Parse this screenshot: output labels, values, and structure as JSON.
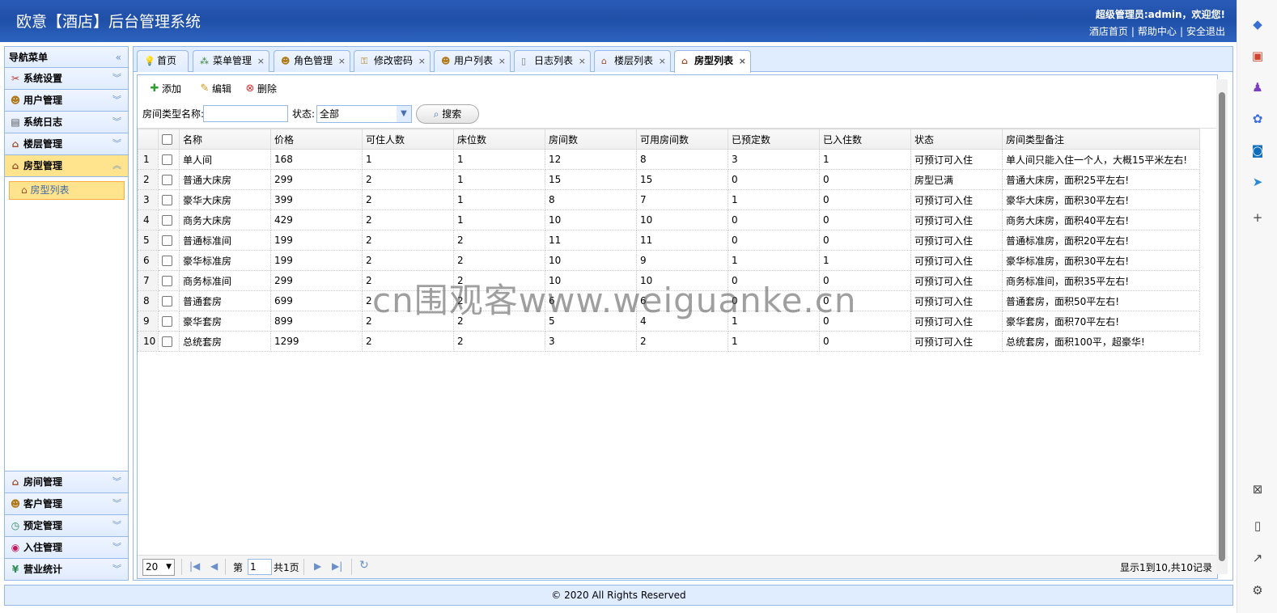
{
  "header": {
    "title": "欧意【酒店】后台管理系统",
    "user_text": "超级管理员:admin，欢迎您!",
    "links": [
      "酒店首页",
      "帮助中心",
      "安全退出"
    ]
  },
  "sidebar": {
    "title": "导航菜单",
    "top_items": [
      {
        "label": "系统设置"
      },
      {
        "label": "用户管理"
      },
      {
        "label": "系统日志"
      },
      {
        "label": "楼层管理"
      },
      {
        "label": "房型管理"
      }
    ],
    "sub_item": "房型列表",
    "bottom_items": [
      {
        "label": "房间管理"
      },
      {
        "label": "客户管理"
      },
      {
        "label": "预定管理"
      },
      {
        "label": "入住管理"
      },
      {
        "label": "营业统计"
      }
    ]
  },
  "tabs": [
    "首页",
    "菜单管理",
    "角色管理",
    "修改密码",
    "用户列表",
    "日志列表",
    "楼层列表",
    "房型列表"
  ],
  "toolbar": {
    "add": "添加",
    "edit": "编辑",
    "delete": "删除"
  },
  "search": {
    "name_label": "房间类型名称:",
    "name_value": "",
    "status_label": "状态:",
    "status_value": "全部",
    "button": "搜索"
  },
  "table": {
    "columns": [
      "名称",
      "价格",
      "可住人数",
      "床位数",
      "房间数",
      "可用房间数",
      "已预定数",
      "已入住数",
      "状态",
      "房间类型备注"
    ],
    "rows": [
      [
        "1",
        "单人间",
        "168",
        "1",
        "1",
        "12",
        "8",
        "3",
        "1",
        "可预订可入住",
        "单人间只能入住一个人，大概15平米左右!"
      ],
      [
        "2",
        "普通大床房",
        "299",
        "2",
        "1",
        "15",
        "15",
        "0",
        "0",
        "房型已满",
        "普通大床房，面积25平左右!"
      ],
      [
        "3",
        "豪华大床房",
        "399",
        "2",
        "1",
        "8",
        "7",
        "1",
        "0",
        "可预订可入住",
        "豪华大床房，面积30平左右!"
      ],
      [
        "4",
        "商务大床房",
        "429",
        "2",
        "1",
        "10",
        "10",
        "0",
        "0",
        "可预订可入住",
        "商务大床房，面积40平左右!"
      ],
      [
        "5",
        "普通标准间",
        "199",
        "2",
        "2",
        "11",
        "11",
        "0",
        "0",
        "可预订可入住",
        "普通标准房，面积20平左右!"
      ],
      [
        "6",
        "豪华标准房",
        "199",
        "2",
        "2",
        "10",
        "9",
        "1",
        "1",
        "可预订可入住",
        "豪华标准房，面积30平左右!"
      ],
      [
        "7",
        "商务标准间",
        "299",
        "2",
        "2",
        "10",
        "10",
        "0",
        "0",
        "可预订可入住",
        "商务标准间，面积35平左右!"
      ],
      [
        "8",
        "普通套房",
        "699",
        "2",
        "2",
        "6",
        "6",
        "0",
        "0",
        "可预订可入住",
        "普通套房，面积50平左右!"
      ],
      [
        "9",
        "豪华套房",
        "899",
        "2",
        "2",
        "5",
        "4",
        "1",
        "0",
        "可预订可入住",
        "豪华套房，面积70平左右!"
      ],
      [
        "10",
        "总统套房",
        "1299",
        "2",
        "2",
        "3",
        "2",
        "1",
        "0",
        "可预订可入住",
        "总统套房，面积100平，超豪华!"
      ]
    ]
  },
  "pager": {
    "page_size": "20",
    "page_prefix": "第",
    "page_value": "1",
    "page_total": "共1页",
    "info": "显示1到10,共10记录"
  },
  "footer": "© 2020 All Rights Reserved",
  "watermark": "cn围观客www.weiguanke.cn"
}
